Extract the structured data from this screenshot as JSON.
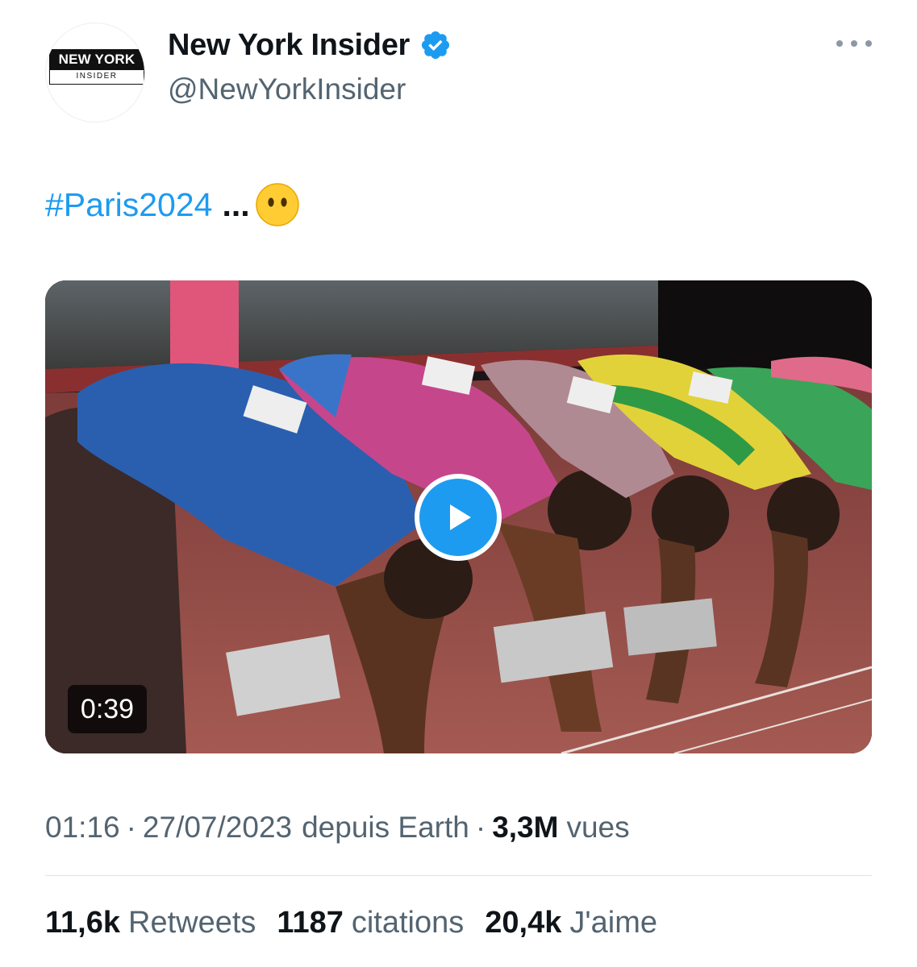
{
  "tweet": {
    "author": {
      "display_name": "New York Insider",
      "handle": "@NewYorkInsider",
      "verified": true,
      "avatar": {
        "logo_top": "NEW YORK",
        "logo_bottom": "INSIDER"
      }
    },
    "more_icon": "more-horizontal-icon",
    "text": {
      "hashtag": "#Paris2024",
      "ellipsis": "...",
      "emoji": "face-without-mouth"
    },
    "media": {
      "type": "video",
      "duration": "0:39",
      "play_icon": "play-icon"
    },
    "meta": {
      "time": "01:16",
      "separator": "·",
      "date": "27/07/2023",
      "source": "depuis Earth",
      "views_count": "3,3M",
      "views_label": "vues"
    },
    "stats": [
      {
        "count": "11,6k",
        "label": "Retweets"
      },
      {
        "count": "1187",
        "label": "citations"
      },
      {
        "count": "20,4k",
        "label": "J'aime"
      }
    ]
  },
  "colors": {
    "accent": "#1d9bf0",
    "text": "#0f1419",
    "muted": "#536471",
    "divider": "#dfe3e6"
  }
}
